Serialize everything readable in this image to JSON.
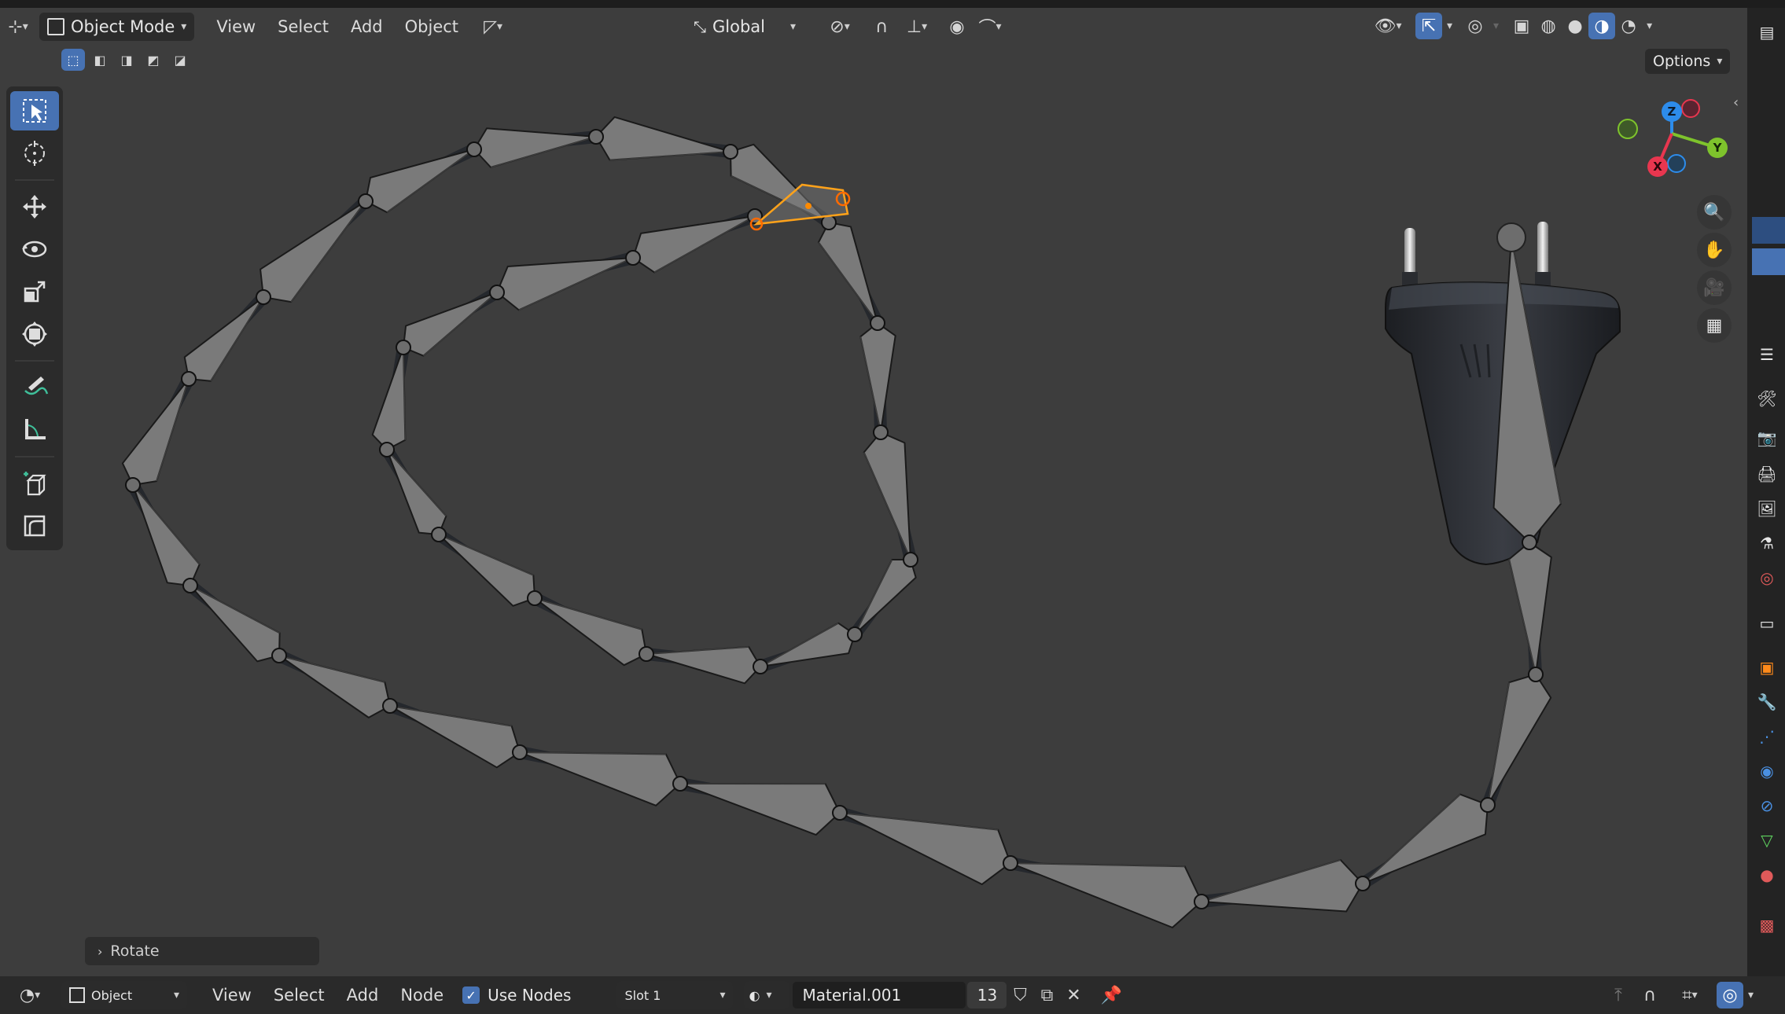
{
  "header": {
    "mode": "Object Mode",
    "menus": [
      "View",
      "Select",
      "Add",
      "Object"
    ],
    "orientation": "Global",
    "options_label": "Options"
  },
  "toolbar": {
    "tools": [
      "select-box",
      "cursor",
      "move",
      "rotate",
      "scale",
      "transform",
      "annotate",
      "measure",
      "add-cube",
      "shear"
    ],
    "active": "select-box"
  },
  "viewport": {
    "gizmo_axes": [
      "Z",
      "Y",
      "X"
    ],
    "last_operator": "Rotate"
  },
  "bottom_bar": {
    "editor_mode": "Object",
    "menus": [
      "View",
      "Select",
      "Add",
      "Node"
    ],
    "use_nodes_label": "Use Nodes",
    "use_nodes_checked": true,
    "slot": "Slot 1",
    "material": "Material.001",
    "user_count": "13"
  },
  "colors": {
    "viewport_bg": "#3d3d3d",
    "header_bg": "#2b2b2b",
    "accent": "#4772b3",
    "bone": "#7a7a7a",
    "selected_bone": "#ffa21a",
    "axis_x": "#e8364f",
    "axis_y": "#7ec32c",
    "axis_z": "#2d8ceb"
  }
}
